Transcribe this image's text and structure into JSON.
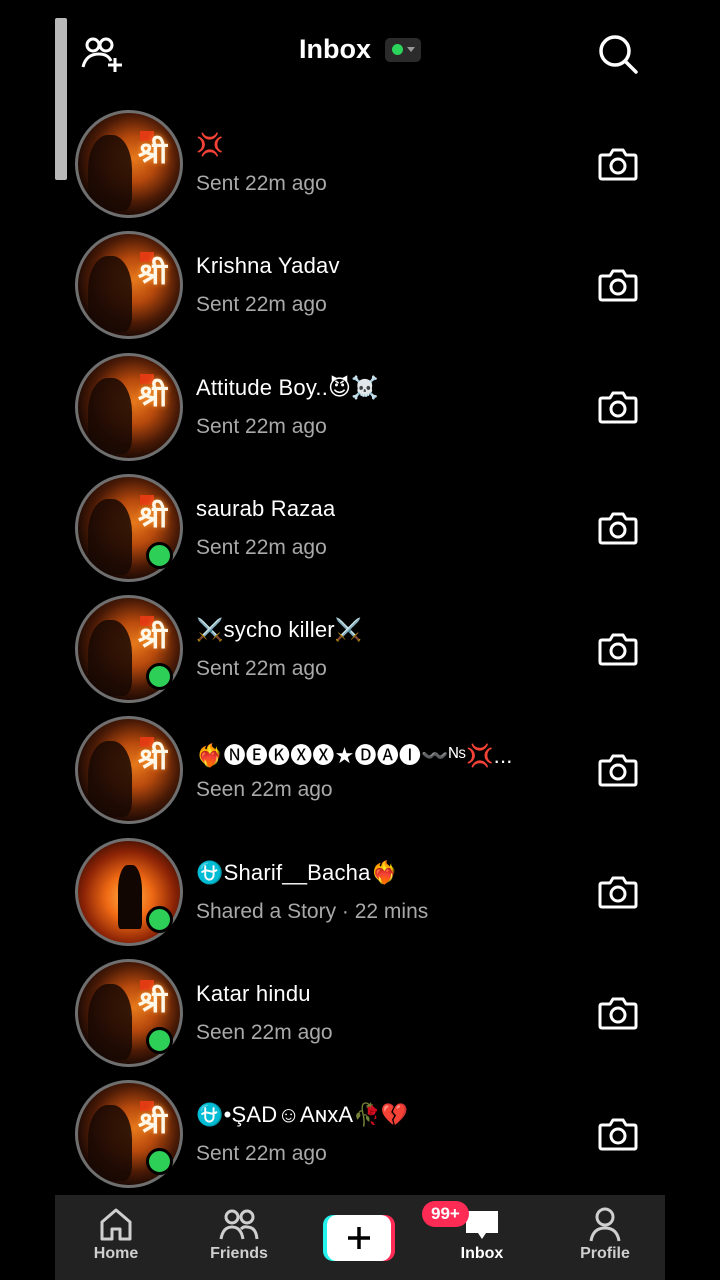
{
  "header": {
    "title": "Inbox",
    "status_color": "#2bd45a"
  },
  "conversations": [
    {
      "name": "💢",
      "status": "Sent 22m ago",
      "online": false,
      "avatar": "shri-ram"
    },
    {
      "name": "Krishna Yadav",
      "status": "Sent 22m ago",
      "online": false,
      "avatar": "shri-ram"
    },
    {
      "name": "Attitude Boy..😈☠️",
      "status": "Sent 22m ago",
      "online": false,
      "avatar": "shri-ram"
    },
    {
      "name": "saurab Razaa",
      "status": "Sent 22m ago",
      "online": true,
      "avatar": "shri-ram"
    },
    {
      "name": "⚔️sycho killer⚔️",
      "status": "Sent 22m ago",
      "online": true,
      "avatar": "shri-ram"
    },
    {
      "name": "❤️‍🔥🅝🅔🅚🅧🅧★🅓🅐🅘〰️ᴺˢ💢...",
      "status": "Seen 22m ago",
      "online": false,
      "avatar": "shri-ram"
    },
    {
      "name": "⛎Sharif__Bacha❤️‍🔥",
      "status": "Shared a Story · 22 mins",
      "online": true,
      "avatar": "warrior"
    },
    {
      "name": "Katar hindu",
      "status": "Seen 22m ago",
      "online": true,
      "avatar": "shri-ram"
    },
    {
      "name": "⛎•ŞAD☺AɴxA🥀💔",
      "status": "Sent 22m ago",
      "online": true,
      "avatar": "shri-ram"
    }
  ],
  "avatar_glyph": "श्री",
  "bottom_nav": {
    "home": "Home",
    "friends": "Friends",
    "inbox": "Inbox",
    "profile": "Profile",
    "inbox_badge": "99+"
  },
  "colors": {
    "online": "#2ecf57",
    "badge": "#fe2c55",
    "create_left": "#25f4ee",
    "create_right": "#fe2c55"
  }
}
